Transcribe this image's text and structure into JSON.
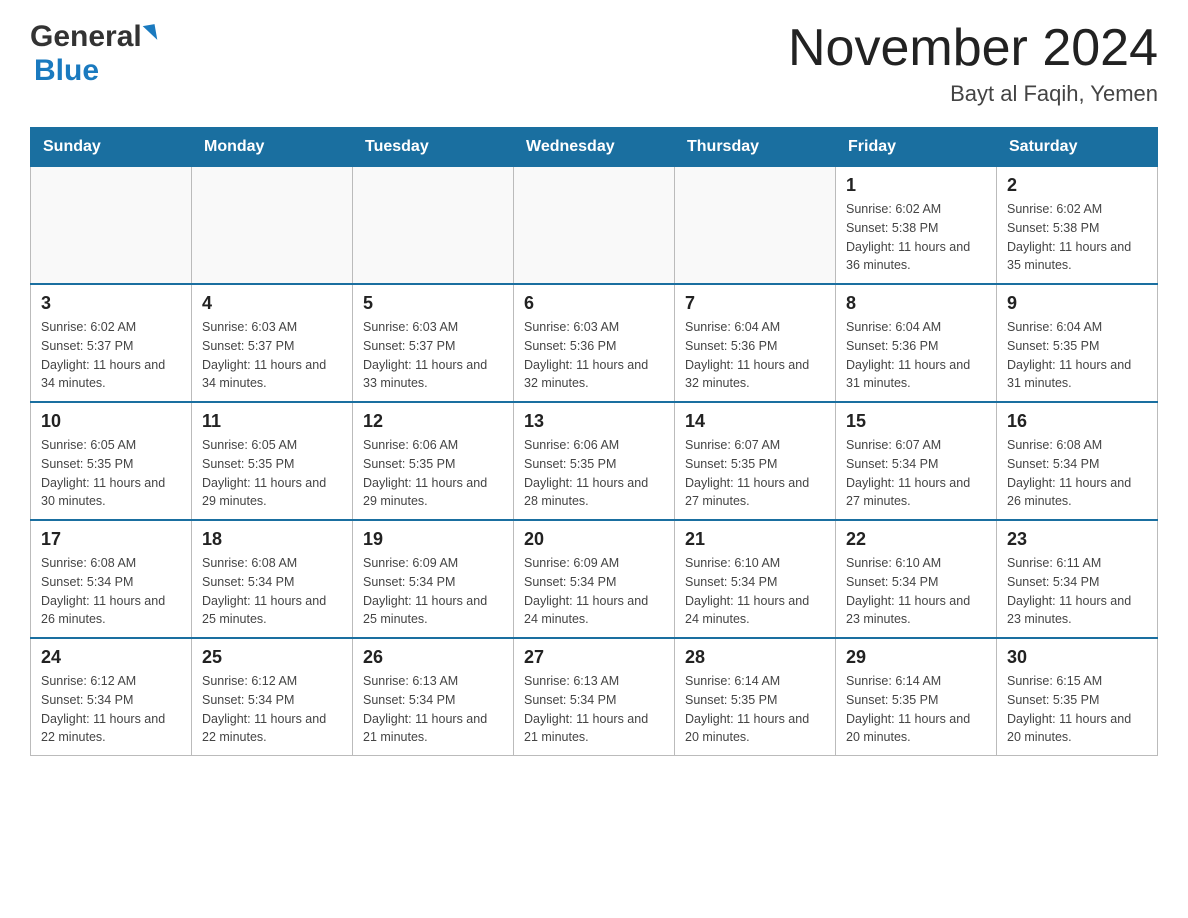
{
  "header": {
    "logo_general": "General",
    "logo_blue": "Blue",
    "title": "November 2024",
    "subtitle": "Bayt al Faqih, Yemen"
  },
  "days_of_week": [
    "Sunday",
    "Monday",
    "Tuesday",
    "Wednesday",
    "Thursday",
    "Friday",
    "Saturday"
  ],
  "weeks": [
    [
      {
        "day": "",
        "info": ""
      },
      {
        "day": "",
        "info": ""
      },
      {
        "day": "",
        "info": ""
      },
      {
        "day": "",
        "info": ""
      },
      {
        "day": "",
        "info": ""
      },
      {
        "day": "1",
        "info": "Sunrise: 6:02 AM\nSunset: 5:38 PM\nDaylight: 11 hours and 36 minutes."
      },
      {
        "day": "2",
        "info": "Sunrise: 6:02 AM\nSunset: 5:38 PM\nDaylight: 11 hours and 35 minutes."
      }
    ],
    [
      {
        "day": "3",
        "info": "Sunrise: 6:02 AM\nSunset: 5:37 PM\nDaylight: 11 hours and 34 minutes."
      },
      {
        "day": "4",
        "info": "Sunrise: 6:03 AM\nSunset: 5:37 PM\nDaylight: 11 hours and 34 minutes."
      },
      {
        "day": "5",
        "info": "Sunrise: 6:03 AM\nSunset: 5:37 PM\nDaylight: 11 hours and 33 minutes."
      },
      {
        "day": "6",
        "info": "Sunrise: 6:03 AM\nSunset: 5:36 PM\nDaylight: 11 hours and 32 minutes."
      },
      {
        "day": "7",
        "info": "Sunrise: 6:04 AM\nSunset: 5:36 PM\nDaylight: 11 hours and 32 minutes."
      },
      {
        "day": "8",
        "info": "Sunrise: 6:04 AM\nSunset: 5:36 PM\nDaylight: 11 hours and 31 minutes."
      },
      {
        "day": "9",
        "info": "Sunrise: 6:04 AM\nSunset: 5:35 PM\nDaylight: 11 hours and 31 minutes."
      }
    ],
    [
      {
        "day": "10",
        "info": "Sunrise: 6:05 AM\nSunset: 5:35 PM\nDaylight: 11 hours and 30 minutes."
      },
      {
        "day": "11",
        "info": "Sunrise: 6:05 AM\nSunset: 5:35 PM\nDaylight: 11 hours and 29 minutes."
      },
      {
        "day": "12",
        "info": "Sunrise: 6:06 AM\nSunset: 5:35 PM\nDaylight: 11 hours and 29 minutes."
      },
      {
        "day": "13",
        "info": "Sunrise: 6:06 AM\nSunset: 5:35 PM\nDaylight: 11 hours and 28 minutes."
      },
      {
        "day": "14",
        "info": "Sunrise: 6:07 AM\nSunset: 5:35 PM\nDaylight: 11 hours and 27 minutes."
      },
      {
        "day": "15",
        "info": "Sunrise: 6:07 AM\nSunset: 5:34 PM\nDaylight: 11 hours and 27 minutes."
      },
      {
        "day": "16",
        "info": "Sunrise: 6:08 AM\nSunset: 5:34 PM\nDaylight: 11 hours and 26 minutes."
      }
    ],
    [
      {
        "day": "17",
        "info": "Sunrise: 6:08 AM\nSunset: 5:34 PM\nDaylight: 11 hours and 26 minutes."
      },
      {
        "day": "18",
        "info": "Sunrise: 6:08 AM\nSunset: 5:34 PM\nDaylight: 11 hours and 25 minutes."
      },
      {
        "day": "19",
        "info": "Sunrise: 6:09 AM\nSunset: 5:34 PM\nDaylight: 11 hours and 25 minutes."
      },
      {
        "day": "20",
        "info": "Sunrise: 6:09 AM\nSunset: 5:34 PM\nDaylight: 11 hours and 24 minutes."
      },
      {
        "day": "21",
        "info": "Sunrise: 6:10 AM\nSunset: 5:34 PM\nDaylight: 11 hours and 24 minutes."
      },
      {
        "day": "22",
        "info": "Sunrise: 6:10 AM\nSunset: 5:34 PM\nDaylight: 11 hours and 23 minutes."
      },
      {
        "day": "23",
        "info": "Sunrise: 6:11 AM\nSunset: 5:34 PM\nDaylight: 11 hours and 23 minutes."
      }
    ],
    [
      {
        "day": "24",
        "info": "Sunrise: 6:12 AM\nSunset: 5:34 PM\nDaylight: 11 hours and 22 minutes."
      },
      {
        "day": "25",
        "info": "Sunrise: 6:12 AM\nSunset: 5:34 PM\nDaylight: 11 hours and 22 minutes."
      },
      {
        "day": "26",
        "info": "Sunrise: 6:13 AM\nSunset: 5:34 PM\nDaylight: 11 hours and 21 minutes."
      },
      {
        "day": "27",
        "info": "Sunrise: 6:13 AM\nSunset: 5:34 PM\nDaylight: 11 hours and 21 minutes."
      },
      {
        "day": "28",
        "info": "Sunrise: 6:14 AM\nSunset: 5:35 PM\nDaylight: 11 hours and 20 minutes."
      },
      {
        "day": "29",
        "info": "Sunrise: 6:14 AM\nSunset: 5:35 PM\nDaylight: 11 hours and 20 minutes."
      },
      {
        "day": "30",
        "info": "Sunrise: 6:15 AM\nSunset: 5:35 PM\nDaylight: 11 hours and 20 minutes."
      }
    ]
  ]
}
